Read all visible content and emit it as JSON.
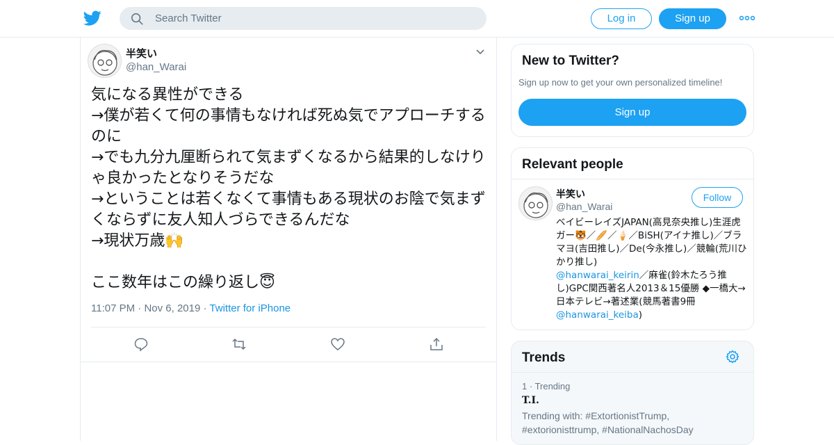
{
  "header": {
    "search_placeholder": "Search Twitter",
    "login_label": "Log in",
    "signup_label": "Sign up"
  },
  "tweet": {
    "author_name": "半笑い",
    "author_handle": "@han_Warai",
    "text": "気になる異性ができる\n→僕が若くて何の事情もなければ死ぬ気でアプローチするのに\n→でも九分九厘断られて気まずくなるから結果的しなけりゃ良かったとなりそうだな\n→ということは若くなくて事情もある現状のお陰で気まずくならずに友人知人づらできるんだな\n→現状万歳🙌\n\nここ数年はこの繰り返し😇",
    "time": "11:07 PM",
    "date": "Nov 6, 2019",
    "source": "Twitter for iPhone"
  },
  "new_to_twitter": {
    "title": "New to Twitter?",
    "subtitle": "Sign up now to get your own personalized timeline!",
    "button_label": "Sign up"
  },
  "relevant_people": {
    "title": "Relevant people",
    "name": "半笑い",
    "handle": "@han_Warai",
    "follow_label": "Follow",
    "bio_part1": "ベイビーレイズJAPAN(高見奈央推し)生涯虎ガー🐯／🥖／🍦／BiSH(アイナ推し)／ブラマヨ(吉田推し)／De(今永推し)／競輪(荒川ひかり推し)",
    "bio_link1": "@hanwarai_keirin",
    "bio_part2": "／麻雀(鈴木たろう推し)GPC関西著名人2013＆15優勝 ◆一橋大→日本テレビ→著述業(競馬著書9冊",
    "bio_link2": "@hanwarai_keiba",
    "bio_part3": ")"
  },
  "trends": {
    "title": "Trends",
    "items": [
      {
        "rank": "1",
        "label": "Trending",
        "name": "T.I.",
        "trending_with": "Trending with: #ExtortionistTrump, #extorionisttrump, #NationalNachosDay"
      }
    ]
  },
  "colors": {
    "accent": "#1da1f2",
    "link": "#1b95e0",
    "muted": "#657786",
    "border": "#e6ecf0"
  }
}
